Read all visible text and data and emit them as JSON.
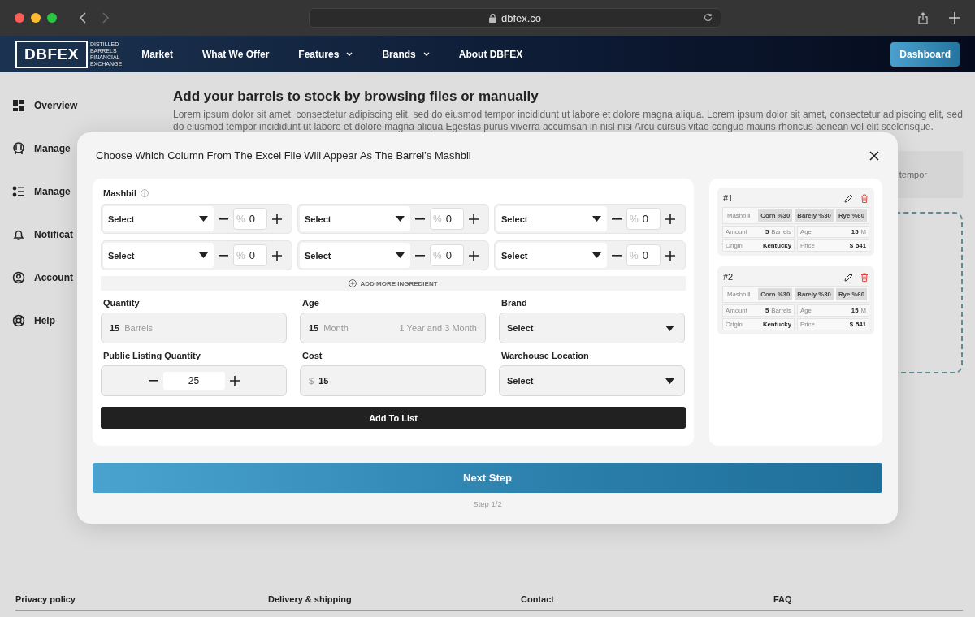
{
  "browser": {
    "url": "dbfex.co",
    "back_disabled": false,
    "forward_disabled": true
  },
  "nav": {
    "logo": "DBFEX",
    "tagline": [
      "DISTILLED",
      "BARRELS",
      "FINANCIAL",
      "EXCHANGE"
    ],
    "links": [
      {
        "label": "Market",
        "dropdown": false
      },
      {
        "label": "What We Offer",
        "dropdown": false
      },
      {
        "label": "Features",
        "dropdown": true
      },
      {
        "label": "Brands",
        "dropdown": true
      },
      {
        "label": "About DBFEX",
        "dropdown": false
      }
    ],
    "dashboard_button": "Dashboard"
  },
  "sidebar": {
    "items": [
      {
        "label": "Overview"
      },
      {
        "label": "Manage"
      },
      {
        "label": "Manage"
      },
      {
        "label": "Notificat"
      },
      {
        "label": "Account"
      },
      {
        "label": "Help"
      }
    ]
  },
  "page": {
    "heading": "Add your barrels to stock by browsing files or manually",
    "description": "Lorem ipsum dolor sit amet, consectetur adipiscing elit, sed do eiusmod tempor incididunt ut labore et dolore magna aliqua. Lorem ipsum dolor sit amet, consectetur adipiscing elit, sed do eiusmod tempor incididunt ut labore et dolore magna aliqua Egestas purus viverra accumsan in nisl nisi Arcu cursus vitae congue mauris rhoncus aenean vel elit scelerisque.",
    "card_text": "tempor"
  },
  "modal": {
    "title": "Choose Which Column From The Excel File Will Appear As The Barrel’s Mashbil",
    "mashbil_label": "Mashbil",
    "ingredients": [
      {
        "select": "Select",
        "percent_sign": "%",
        "value": "0"
      },
      {
        "select": "Select",
        "percent_sign": "%",
        "value": "0"
      },
      {
        "select": "Select",
        "percent_sign": "%",
        "value": "0"
      },
      {
        "select": "Select",
        "percent_sign": "%",
        "value": "0"
      },
      {
        "select": "Select",
        "percent_sign": "%",
        "value": "0"
      },
      {
        "select": "Select",
        "percent_sign": "%",
        "value": "0"
      }
    ],
    "add_more": "ADD MORE INGREDIENT",
    "fields": [
      {
        "kind": "unit",
        "label": "Quantity",
        "value": "15",
        "unit": "Barrels"
      },
      {
        "kind": "unit",
        "label": "Age",
        "value": "15",
        "unit": "Month",
        "hint": "1 Year and 3 Month"
      },
      {
        "kind": "select",
        "label": "Brand",
        "value": "Select"
      },
      {
        "kind": "stepper",
        "label": "Public Listing Quantity",
        "value": "25"
      },
      {
        "kind": "prefix",
        "label": "Cost",
        "prefix": "$",
        "value": "15"
      },
      {
        "kind": "select",
        "label": "Warehouse Location",
        "value": "Select"
      }
    ],
    "add_button": "Add To List",
    "barrels": [
      {
        "number": "#1",
        "mashbill_label": "Mashbill",
        "ingredients": [
          "Corn %30",
          "Barely %30",
          "Rye %60"
        ],
        "amount_label": "Amount",
        "amount": "5",
        "amount_unit": "Barrels",
        "age_label": "Age",
        "age": "15",
        "age_unit": "M",
        "origin_label": "Origin",
        "origin": "Kentucky",
        "price_label": "Price",
        "currency": "$",
        "price": "541"
      },
      {
        "number": "#2",
        "mashbill_label": "Mashbill",
        "ingredients": [
          "Corn %30",
          "Barely %30",
          "Rye %60"
        ],
        "amount_label": "Amount",
        "amount": "5",
        "amount_unit": "Barrels",
        "age_label": "Age",
        "age": "15",
        "age_unit": "M",
        "origin_label": "Origin",
        "origin": "Kentucky",
        "price_label": "Price",
        "currency": "$",
        "price": "541"
      }
    ],
    "next_button": "Next Step",
    "step": "Step 1/2"
  },
  "footer": {
    "links": [
      "Privacy policy",
      "Delivery & shipping",
      "Contact",
      "FAQ"
    ]
  }
}
